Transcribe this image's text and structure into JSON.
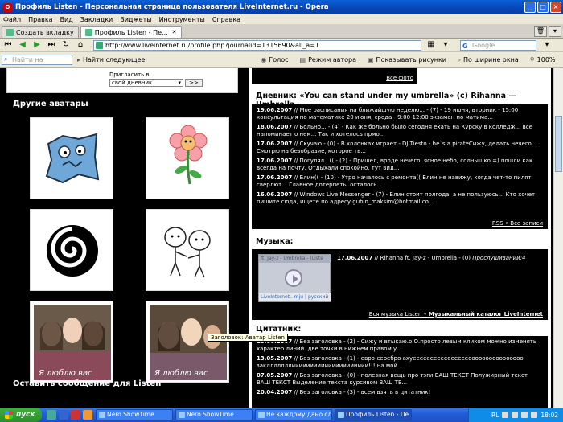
{
  "window": {
    "title": "Профиль Listen - Персональная страница пользователя LiveInternet.ru - Opera"
  },
  "menu": [
    "Файл",
    "Правка",
    "Вид",
    "Закладки",
    "Виджеты",
    "Инструменты",
    "Справка"
  ],
  "tabs": [
    {
      "label": "Создать вкладку"
    },
    {
      "label": "Профиль Listen - Пе..."
    }
  ],
  "nav": {
    "url": "http://www.liveinternet.ru/profile.php?journalid=1315690&all_a=1",
    "search_placeholder": "Google"
  },
  "findbar": {
    "find_placeholder": "Найти на странице",
    "find_next": "Найти следующее",
    "voice": "Голос",
    "author_mode": "Режим автора",
    "show_images": "Показывать рисунки",
    "fit_width": "По ширине окна",
    "zoom": "100%"
  },
  "invite": {
    "label": "Пригласить в",
    "select": "свой дневник",
    "go": ">>"
  },
  "avatars": {
    "title": "Другие аватары",
    "tooltip": "Заголовок: Аватар Listen",
    "avatar_caption": "Я люблю вас"
  },
  "photos_link": "Все фото",
  "diary": {
    "title": "Дневник: «You can stand under my umbrella» (c) Rihanna — Umbrella",
    "entries": [
      {
        "date": "19.06.2007",
        "text": "// Мое расписания на ближайшую неделю... - (7) - 19 июня, вторник - 15:00 консультация по математике 20 июня, среда - 9:00-12:00 экзамен по матима..."
      },
      {
        "date": "18.06.2007",
        "text": "// Больно... - (4) - Как же больно было сегодня ехать на Курску в колледж... все напоминает о нем... Так и хотелось прмо..."
      },
      {
        "date": "17.06.2007",
        "text": "// Скучаю - (0) - В колонках играет - DJ Tiesto - he`s a pirateСижу, делать нечего... Смотрю на безобразие, которое тв..."
      },
      {
        "date": "17.06.2007",
        "text": "// Погулял...(( - (2) - Пришел, вроде нечего, ясное небо, солнышко =) пошли как всегда на почту. Отдыхали спокойно, тут вид..."
      },
      {
        "date": "17.06.2007",
        "text": "// Блин(( - (10) - Утро началось с ремонта(( Блин не навижу, когда чет-то пилят, сверлют... Главное дотерпеть, осталось..."
      },
      {
        "date": "16.06.2007",
        "text": "// Windows Live Messenger - (7) - Блин стоит полгода, а не пользуюсь... Кто хочет пишите сюда, ищете по адресу gubin_maksim@hotmail.co..."
      }
    ],
    "rss": "RSS",
    "all_posts": "Все записи"
  },
  "music": {
    "title": "Музыка:",
    "player_title": "ft. Jay-z - Umbrella - (Liste",
    "player_foot": "LiveInternet.. mju | русский",
    "entry_date": "17.06.2007",
    "entry_text": "// Rihanna ft. Jay-z - Umbrella - (0)",
    "listens": "Прослушиваний:4",
    "all_music": "Вся музыка Listen",
    "catalog": "Музыкальный каталог LiveInternet"
  },
  "quotes": {
    "title": "Цитатник:",
    "entries": [
      {
        "date": "15.06.2007",
        "text": "// Без заголовка - (2) - Сижу и втыкаю.о.О.просто левым кликом можно изменять характер линий. две точки в нижнем правом у..."
      },
      {
        "date": "13.05.2007",
        "text": "// Без заголовка - (1) - евро-серебро ахуееееееееееееееееоооооооооооооооо заклллллллиииииииииииииииииииии!!! на мой ..."
      },
      {
        "date": "07.05.2007",
        "text": "// Без заголовка - (0) - полезная вещь про тэги ВАШ ТЕКСТ Полужирный текст ВАШ ТЕКСТ Выделение текста курсивом ВАШ ТЕ..."
      },
      {
        "date": "20.04.2007",
        "text": "// Без заголовка - (3) - всем взять в цитатник!"
      }
    ]
  },
  "message_title": "Оставить сообщение для Listen",
  "taskbar": {
    "start": "пуск",
    "tasks": [
      "Nero ShowTime",
      "Nero ShowTime",
      "Не каждому дано сл...",
      "Профиль Listen - Пе..."
    ],
    "lang": "RL",
    "time": "18:02"
  }
}
